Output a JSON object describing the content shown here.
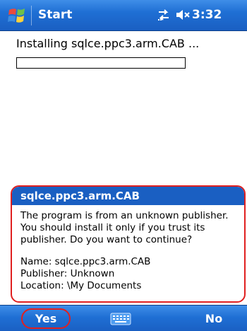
{
  "title_bar": {
    "title": "Start",
    "time": "3:32",
    "icons": [
      "windows-start-flag-icon",
      "connectivity-icon",
      "volume-muted-icon"
    ]
  },
  "install": {
    "status_text": "Installing sqlce.ppc3.arm.CAB ...",
    "progress_percent": 0
  },
  "dialog": {
    "title": "sqlce.ppc3.arm.CAB",
    "message_lines": [
      "The program is from an unknown publisher.",
      "You should install it only if you trust its",
      "publisher. Do you want to continue?"
    ],
    "name_line": "Name: sqlce.ppc3.arm.CAB",
    "publisher_line": "Publisher: Unknown",
    "location_line": "Location: \\My Documents"
  },
  "softkeys": {
    "left": "Yes",
    "right": "No",
    "center_icon": "keyboard-icon"
  },
  "colors": {
    "bar_blue": "#1a5fc2",
    "highlight_red": "#e02020"
  }
}
